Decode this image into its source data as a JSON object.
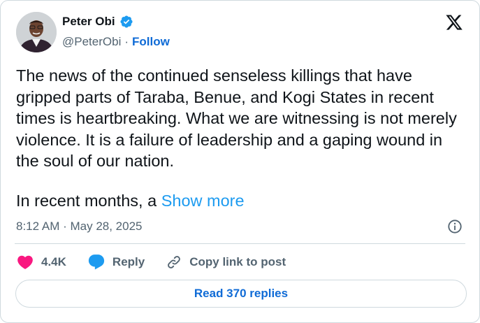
{
  "author": {
    "name": "Peter Obi",
    "handle": "@PeterObi",
    "separator": "·",
    "follow_label": "Follow",
    "verified_icon": "verified-badge-icon"
  },
  "platform_logo": "x-logo-icon",
  "post": {
    "text": "The news of the continued senseless killings that have gripped parts of Taraba, Benue, and Kogi States in recent times is heartbreaking. What we are witnessing is not merely violence. It is a failure of leadership and a gaping wound in the soul of our nation.",
    "second_paragraph": "In recent months, a",
    "show_more_label": "Show more",
    "timestamp": "8:12 AM · May 28, 2025"
  },
  "actions": {
    "likes": "4.4K",
    "reply_label": "Reply",
    "copy_link_label": "Copy link to post"
  },
  "read_replies_label": "Read 370 replies",
  "colors": {
    "like": "#f91880",
    "reply": "#1d9bf0",
    "link": "#1d9bf0",
    "follow": "#0f6bd6",
    "verified": "#1d9bf0"
  }
}
